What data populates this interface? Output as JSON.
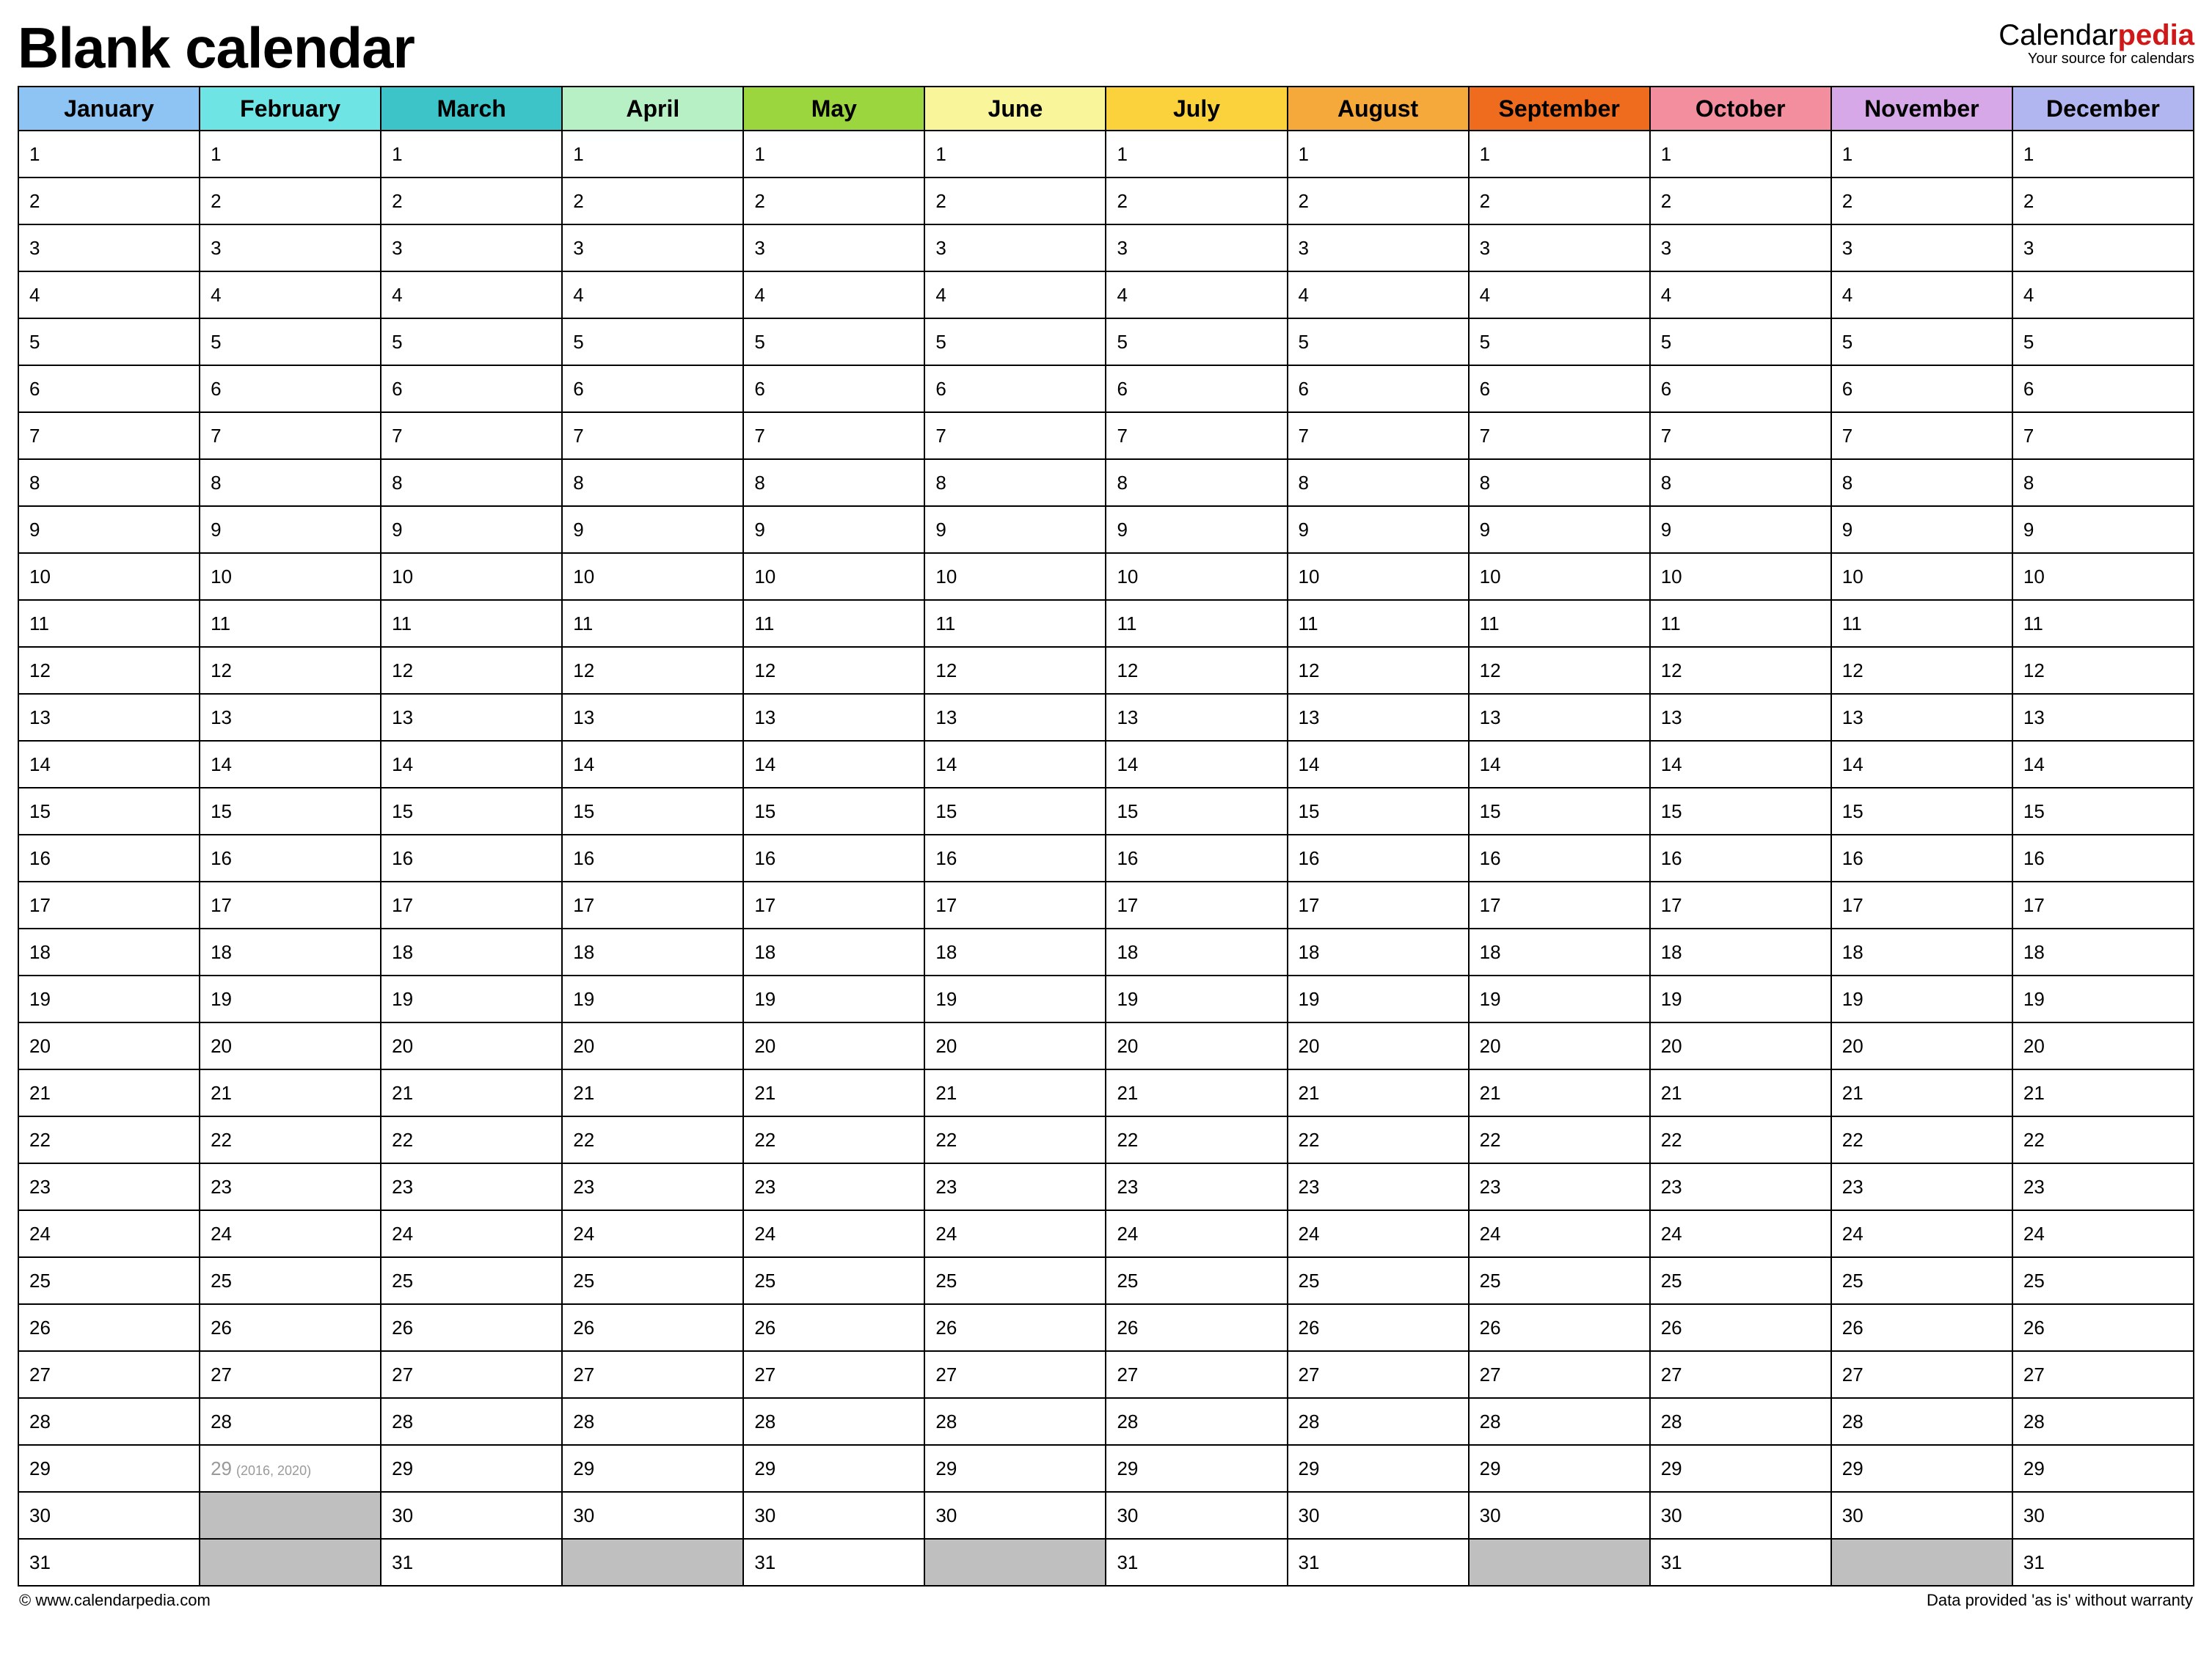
{
  "title": "Blank calendar",
  "brand": {
    "part1": "Calendar",
    "part2": "pedia",
    "tagline": "Your source for calendars"
  },
  "months": [
    {
      "name": "January",
      "color": "#8ec4f3",
      "days": 31
    },
    {
      "name": "February",
      "color": "#6fe4e4",
      "days": 28,
      "leap": {
        "day": 29,
        "note": "(2016, 2020)"
      }
    },
    {
      "name": "March",
      "color": "#3dc4c8",
      "days": 31
    },
    {
      "name": "April",
      "color": "#b8f0c6",
      "days": 30
    },
    {
      "name": "May",
      "color": "#9cd63f",
      "days": 31
    },
    {
      "name": "June",
      "color": "#f9f59b",
      "days": 30
    },
    {
      "name": "July",
      "color": "#fbd23c",
      "days": 31
    },
    {
      "name": "August",
      "color": "#f6a93b",
      "days": 31
    },
    {
      "name": "September",
      "color": "#ef6c1f",
      "days": 30
    },
    {
      "name": "October",
      "color": "#f28e9e",
      "days": 31
    },
    {
      "name": "November",
      "color": "#d6a8e8",
      "days": 30
    },
    {
      "name": "December",
      "color": "#b2b6f0",
      "days": 31
    }
  ],
  "max_days": 31,
  "footer": {
    "left": "© www.calendarpedia.com",
    "right": "Data provided 'as is' without warranty"
  }
}
